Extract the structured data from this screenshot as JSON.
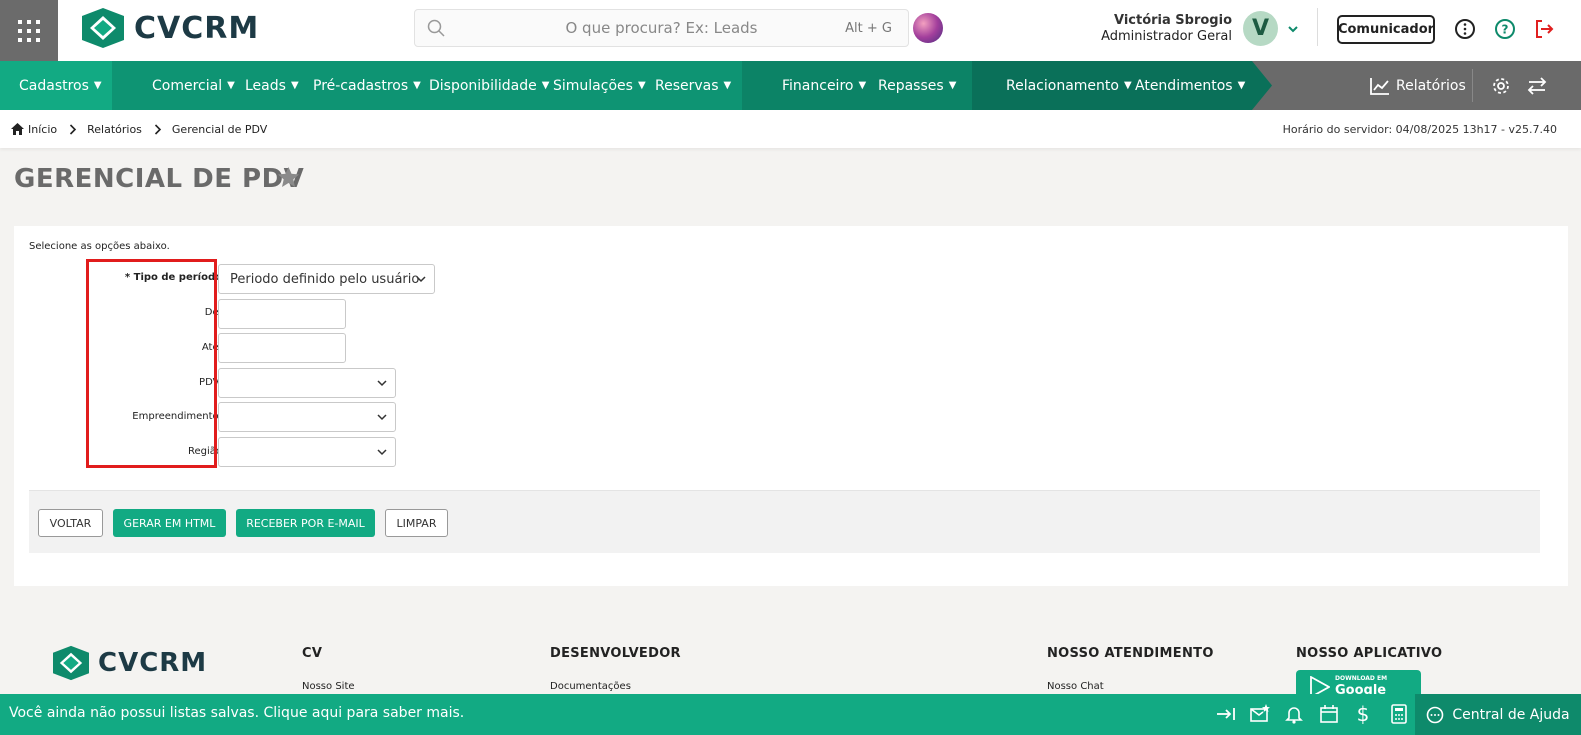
{
  "header": {
    "logo_text": "CVCRM",
    "search_placeholder": "O que procura? Ex: Leads",
    "search_shortcut": "Alt + G",
    "user_name": "Victória Sbrogio",
    "user_role": "Administrador Geral",
    "avatar_letter": "V",
    "comunicador_label": "Comunicador"
  },
  "nav": {
    "items": [
      {
        "label": "Cadastros"
      },
      {
        "label": "Comercial"
      },
      {
        "label": "Leads"
      },
      {
        "label": "Pré-cadastros"
      },
      {
        "label": "Disponibilidade"
      },
      {
        "label": "Simulações"
      },
      {
        "label": "Reservas"
      },
      {
        "label": "Financeiro"
      },
      {
        "label": "Repasses"
      },
      {
        "label": "Relacionamento"
      },
      {
        "label": "Atendimentos"
      }
    ],
    "reports_label": "Relatórios",
    "colors": {
      "green1": "#12aa83",
      "green2": "#0e9473",
      "green3": "#0c7a60",
      "gray": "#6a6a6a"
    }
  },
  "breadcrumb": {
    "home": "Início",
    "level1": "Relatórios",
    "level2": "Gerencial de PDV",
    "server_time": "Horário do servidor: 04/08/2025 13h17 - v25.7.40"
  },
  "page": {
    "title": "GERENCIAL DE PDV",
    "hint": "Selecione as opções abaixo.",
    "fields": {
      "periodo_label": "* Tipo de período",
      "periodo_value": "Periodo definido pelo usuário",
      "de_label": "De:",
      "ate_label": "Até:",
      "pdv_label": "PDV:",
      "empreendimento_label": "Empreendimento:",
      "regiao_label": "Região"
    },
    "buttons": {
      "voltar": "VOLTAR",
      "gerar": "GERAR EM HTML",
      "email": "RECEBER POR E-MAIL",
      "limpar": "LIMPAR"
    }
  },
  "footer": {
    "col_cv": "CV",
    "col_dev": "DESENVOLVEDOR",
    "col_atend": "NOSSO ATENDIMENTO",
    "col_app": "NOSSO APLICATIVO",
    "link_site": "Nosso Site",
    "link_docs": "Documentações",
    "link_chat": "Nosso Chat",
    "gp_small": "DOWNLOAD EM",
    "gp_big": "Google Play"
  },
  "bottombar": {
    "message": "Você ainda não possui listas salvas. Clique aqui para saber mais.",
    "help_label": "Central de Ajuda"
  }
}
